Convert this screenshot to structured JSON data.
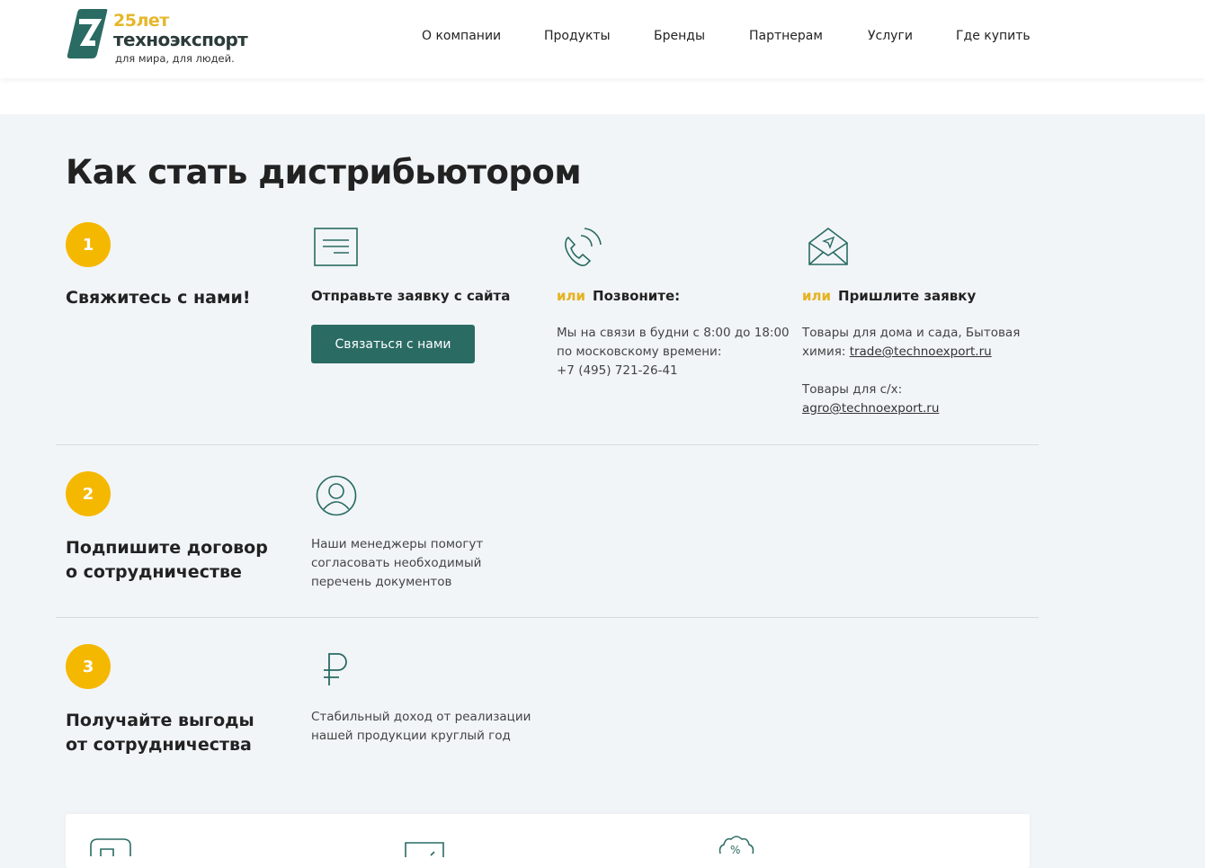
{
  "header": {
    "logo": {
      "years": "25лет",
      "name": "техноэкспорт",
      "tagline": "для мира, для людей."
    },
    "nav": [
      "О компании",
      "Продукты",
      "Бренды",
      "Партнерам",
      "Услуги",
      "Где купить"
    ]
  },
  "title": "Как стать дистрибьютором",
  "steps": [
    {
      "num": "1",
      "title": "Свяжитесь с нами!"
    },
    {
      "num": "2",
      "title": "Подпишите договор о сотрудничестве"
    },
    {
      "num": "3",
      "title": "Получайте выгоды от сотрудничества"
    }
  ],
  "contact": {
    "site": {
      "title": "Отправьте заявку с сайта",
      "button": "Связаться с нами"
    },
    "call": {
      "or": "или",
      "title": "Позвоните:",
      "line1": "Мы на связи в будни с 8:00 до 18:00",
      "line2": "по московскому времени:",
      "phone": "+7 (495) 721-26-41"
    },
    "mail": {
      "or": "или",
      "title": "Пришлите заявку",
      "line1": "Товары для дома и сада, Бытовая",
      "line2": "химия:",
      "email1": "trade@technoexport.ru",
      "line3": "Товары для с/х:",
      "email2": "agro@technoexport.ru"
    }
  },
  "step2_text": [
    "Наши менеджеры помогут",
    "согласовать необходимый",
    "перечень документов"
  ],
  "step3_text": [
    "Стабильный доход от реализации",
    "нашей продукции круглый год"
  ],
  "colors": {
    "accent": "#2a6b63",
    "yellow": "#f5b800"
  }
}
